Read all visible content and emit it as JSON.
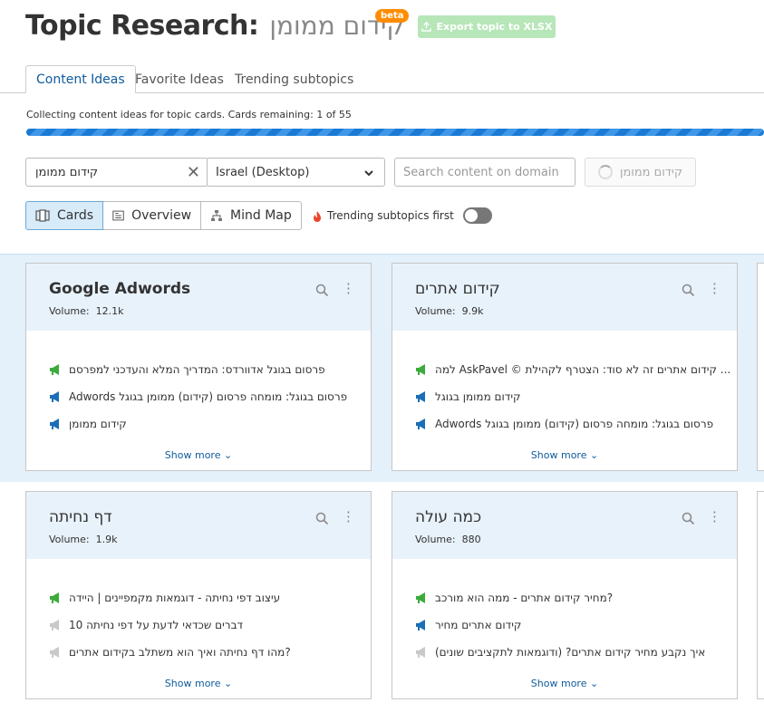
{
  "header": {
    "title": "Topic Research:",
    "topic": "קידום ממומן",
    "beta": "beta",
    "export_label": "Export topic to XLSX"
  },
  "tabs": [
    {
      "label": "Content Ideas"
    },
    {
      "label": "Favorite Ideas"
    },
    {
      "label": "Trending subtopics"
    }
  ],
  "progress": {
    "text": "Collecting content ideas for topic cards. Cards remaining: 1 of 55",
    "remaining": 1,
    "total": 55
  },
  "search": {
    "keyword_value": "קידום ממומן",
    "country_value": "Israel (Desktop)",
    "domain_placeholder": "Search content on domain",
    "get_button_label": "קידום ממומן"
  },
  "views": {
    "cards": "Cards",
    "overview": "Overview",
    "mindmap": "Mind Map"
  },
  "trending_label": "Trending subtopics first",
  "volume_label": "Volume:",
  "show_more": "Show more",
  "cards": [
    {
      "title": "Google Adwords",
      "volume": "12.1k",
      "items": [
        {
          "text": "פרסום בגוגל אדוורדס: המדריך המלא והעדכני למפרסם",
          "type": "green"
        },
        {
          "text": "Adwords פרסום בגוגל: מומחה פרסום (קידום) ממומן בגוגל",
          "type": "blue"
        },
        {
          "text": "קידום ממומן",
          "type": "blue"
        }
      ]
    },
    {
      "title": "קידום אתרים",
      "volume": "9.9k",
      "items": [
        {
          "text": "למה AskPavel © קידום אתרים זה לא סוד: הצטרף לקהילת ...",
          "type": "green"
        },
        {
          "text": "קידום ממומן בגוגל",
          "type": "blue"
        },
        {
          "text": "Adwords פרסום בגוגל: מומחה פרסום (קידום) ממומן בגוגל",
          "type": "blue"
        }
      ]
    },
    {
      "title": "דף נחיתה",
      "volume": "1.9k",
      "items": [
        {
          "text": "עיצוב דפי נחיתה - דוגמאות מקמפיינים | היידה",
          "type": "green"
        },
        {
          "text": "10 דברים שכדאי לדעת על דפי נחיתה",
          "type": "gray"
        },
        {
          "text": "מהו דף נחיתה ואיך הוא משתלב בקידום אתרים?",
          "type": "gray"
        }
      ]
    },
    {
      "title": "כמה עולה",
      "volume": "880",
      "items": [
        {
          "text": "מחיר קידום אתרים - ממה הוא מורכב?",
          "type": "green"
        },
        {
          "text": "קידום אתרים מחיר",
          "type": "blue"
        },
        {
          "text": "איך נקבע מחיר קידום אתרים? (ודוגמאות לתקציבים שונים)",
          "type": "gray"
        }
      ]
    }
  ],
  "colors": {
    "green": "#3bab3b",
    "blue": "#1a6fb7",
    "gray": "#c9c9c9",
    "accent": "#0f5b9c"
  }
}
